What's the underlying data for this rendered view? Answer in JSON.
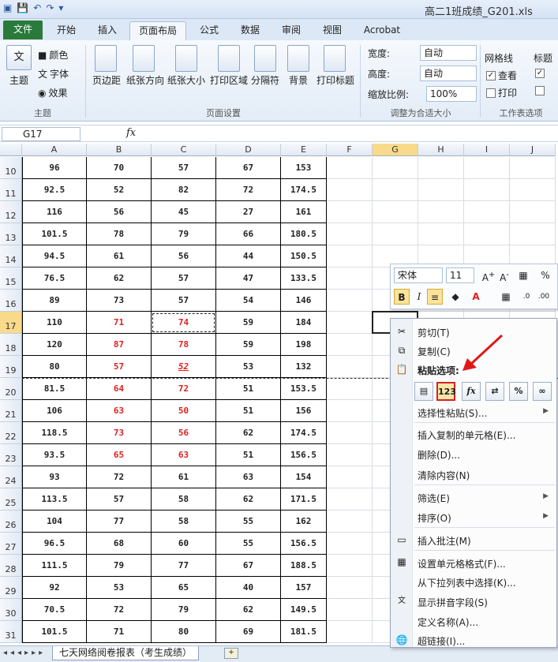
{
  "window": {
    "title": "高二1班成绩_G201.xls"
  },
  "ribbon": {
    "tabs": [
      "文件",
      "开始",
      "插入",
      "页面布局",
      "公式",
      "数据",
      "审阅",
      "视图",
      "Acrobat"
    ],
    "active_tab": "页面布局",
    "theme": {
      "main": "主题",
      "colors": "颜色",
      "fonts": "字体",
      "effects": "效果",
      "group": "主题"
    },
    "page_setup": {
      "buttons": [
        "页边距",
        "纸张方向",
        "纸张大小",
        "打印区域",
        "分隔符",
        "背景",
        "打印标题"
      ],
      "group": "页面设置"
    },
    "scale": {
      "width_label": "宽度:",
      "width_value": "自动",
      "height_label": "高度:",
      "height_value": "自动",
      "zoom_label": "缩放比例:",
      "zoom_value": "100%",
      "group": "调整为合适大小"
    },
    "sheet_options": {
      "gridlines": "网格线",
      "headings": "标题",
      "view": "查看",
      "print": "打印",
      "group": "工作表选项"
    }
  },
  "formula_bar": {
    "name_box": "G17",
    "fx": "fx"
  },
  "grid": {
    "columns": [
      "A",
      "B",
      "C",
      "D",
      "E",
      "F",
      "G",
      "H",
      "I",
      "J"
    ],
    "rows": [
      {
        "n": "10",
        "v": [
          "96",
          "70",
          "57",
          "67",
          "153"
        ]
      },
      {
        "n": "11",
        "v": [
          "92.5",
          "52",
          "82",
          "72",
          "174.5"
        ]
      },
      {
        "n": "12",
        "v": [
          "116",
          "56",
          "45",
          "27",
          "161"
        ]
      },
      {
        "n": "13",
        "v": [
          "101.5",
          "78",
          "79",
          "66",
          "180.5"
        ]
      },
      {
        "n": "14",
        "v": [
          "94.5",
          "61",
          "56",
          "44",
          "150.5"
        ]
      },
      {
        "n": "15",
        "v": [
          "76.5",
          "62",
          "57",
          "47",
          "133.5"
        ]
      },
      {
        "n": "16",
        "v": [
          "89",
          "73",
          "57",
          "54",
          "146"
        ]
      },
      {
        "n": "17",
        "v": [
          "110",
          "71",
          "74",
          "59",
          "184"
        ]
      },
      {
        "n": "18",
        "v": [
          "120",
          "87",
          "78",
          "59",
          "198"
        ]
      },
      {
        "n": "19",
        "v": [
          "80",
          "57",
          "52",
          "53",
          "132"
        ]
      },
      {
        "n": "20",
        "v": [
          "81.5",
          "64",
          "72",
          "51",
          "153.5"
        ]
      },
      {
        "n": "21",
        "v": [
          "106",
          "63",
          "50",
          "51",
          "156"
        ]
      },
      {
        "n": "22",
        "v": [
          "118.5",
          "73",
          "56",
          "62",
          "174.5"
        ]
      },
      {
        "n": "23",
        "v": [
          "93.5",
          "65",
          "63",
          "51",
          "156.5"
        ]
      },
      {
        "n": "24",
        "v": [
          "93",
          "72",
          "61",
          "63",
          "154"
        ]
      },
      {
        "n": "25",
        "v": [
          "113.5",
          "57",
          "58",
          "62",
          "171.5"
        ]
      },
      {
        "n": "26",
        "v": [
          "104",
          "77",
          "58",
          "55",
          "162"
        ]
      },
      {
        "n": "27",
        "v": [
          "96.5",
          "68",
          "60",
          "55",
          "156.5"
        ]
      },
      {
        "n": "28",
        "v": [
          "111.5",
          "79",
          "77",
          "67",
          "188.5"
        ]
      },
      {
        "n": "29",
        "v": [
          "92",
          "53",
          "65",
          "40",
          "157"
        ]
      },
      {
        "n": "30",
        "v": [
          "70.5",
          "72",
          "79",
          "62",
          "149.5"
        ]
      },
      {
        "n": "31",
        "v": [
          "101.5",
          "71",
          "80",
          "69",
          "181.5"
        ]
      }
    ],
    "red_cells": [
      "17-1",
      "17-2",
      "18-1",
      "18-2",
      "19-1",
      "19-2",
      "20-1",
      "20-2",
      "21-1",
      "21-2",
      "22-1",
      "22-2",
      "23-1",
      "23-2"
    ]
  },
  "mini_toolbar": {
    "font": "宋体",
    "size": "11",
    "bold": "B",
    "italic": "I",
    "percent": "%"
  },
  "context_menu": {
    "cut": "剪切(T)",
    "copy": "复制(C)",
    "paste_options": "粘贴选项:",
    "paste_icons": [
      "paste-icon",
      "values-123-icon",
      "formula-fx-icon",
      "transpose-icon",
      "format-percent-icon",
      "link-icon"
    ],
    "values_label": "123",
    "fx_label": "fx",
    "paste_special": "选择性粘贴(S)...",
    "insert_copied": "插入复制的单元格(E)...",
    "delete": "删除(D)...",
    "clear": "清除内容(N)",
    "filter": "筛选(E)",
    "sort": "排序(O)",
    "insert_comment": "插入批注(M)",
    "format_cells": "设置单元格格式(F)...",
    "pick_list": "从下拉列表中选择(K)...",
    "phonetic": "显示拼音字段(S)",
    "define_name": "定义名称(A)...",
    "hyperlink": "超链接(I)..."
  },
  "sheet_tabs": {
    "active": "七天网络阅卷报表（考生成绩）"
  },
  "colors": {
    "accent_red": "#e02020",
    "file_tab": "#2a7a3b",
    "ribbon_bg": "#dde8f6"
  }
}
